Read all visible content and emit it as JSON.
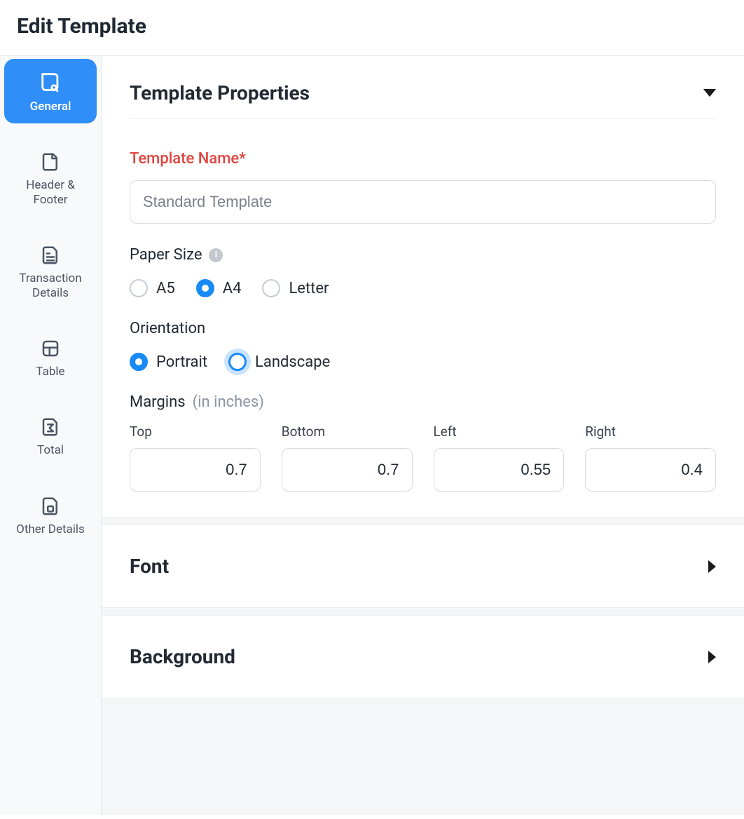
{
  "page": {
    "title": "Edit Template"
  },
  "sidebar": {
    "items": [
      {
        "id": "general",
        "label": "General",
        "active": true
      },
      {
        "id": "header-footer",
        "label": "Header & Footer",
        "active": false
      },
      {
        "id": "transaction-details",
        "label": "Transaction Details",
        "active": false
      },
      {
        "id": "table",
        "label": "Table",
        "active": false
      },
      {
        "id": "total",
        "label": "Total",
        "active": false
      },
      {
        "id": "other-details",
        "label": "Other Details",
        "active": false
      }
    ]
  },
  "properties": {
    "section_title": "Template Properties",
    "template_name": {
      "label": "Template Name*",
      "value": "Standard Template"
    },
    "paper_size": {
      "label": "Paper Size",
      "options": [
        "A5",
        "A4",
        "Letter"
      ],
      "selected": "A4"
    },
    "orientation": {
      "label": "Orientation",
      "options": [
        "Portrait",
        "Landscape"
      ],
      "selected": "Portrait",
      "focused": "Landscape"
    },
    "margins": {
      "label": "Margins",
      "hint": "(in inches)",
      "top": {
        "label": "Top",
        "value": "0.7"
      },
      "bottom": {
        "label": "Bottom",
        "value": "0.7"
      },
      "left": {
        "label": "Left",
        "value": "0.55"
      },
      "right": {
        "label": "Right",
        "value": "0.4"
      }
    }
  },
  "font": {
    "section_title": "Font"
  },
  "background": {
    "section_title": "Background"
  }
}
